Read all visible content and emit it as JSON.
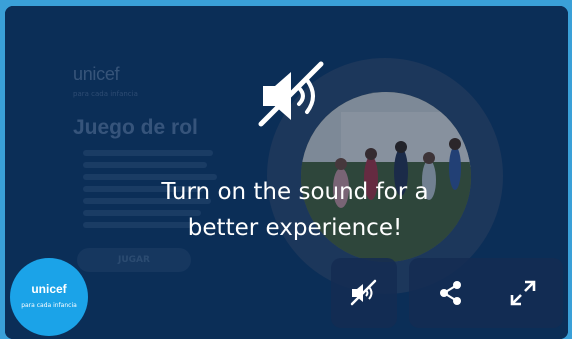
{
  "background_page": {
    "logo": "unicef",
    "logo_subtitle": "para cada infancia",
    "title": "Juego de rol",
    "play_button": "JUGAR"
  },
  "overlay": {
    "message_line1": "Turn on the sound for a",
    "message_line2": "better experience!",
    "mute_icon": "speaker-muted-icon"
  },
  "badge": {
    "logo": "unicef",
    "subtitle": "para cada infancia"
  },
  "controls": {
    "mute_icon": "speaker-muted-icon",
    "share_icon": "share-icon",
    "fullscreen_icon": "expand-icon"
  },
  "colors": {
    "frame": "#0b2f5c",
    "badge": "#1ba3e8",
    "text": "#ffffff"
  }
}
